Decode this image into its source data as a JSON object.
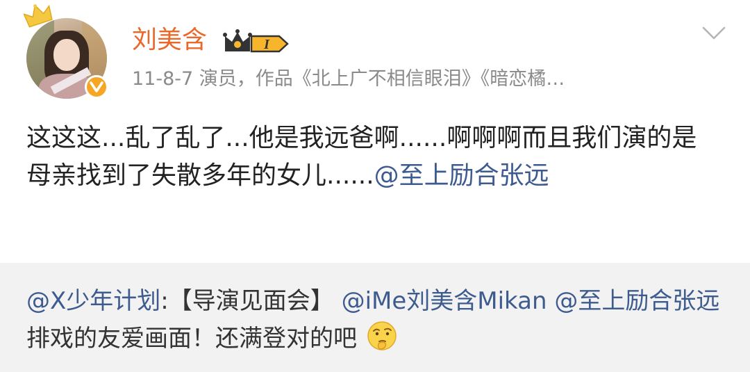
{
  "post": {
    "user_name": "刘美含",
    "vip_level": "I",
    "meta": "11-8-7  演员，作品《北上广不相信眼泪》《暗恋橘…",
    "content_text": "这这这...乱了乱了...他是我远爸啊......啊啊啊而且我们演的是母亲找到了失散多年的女儿......",
    "content_mention": "@至上励合张远",
    "icons": {
      "crown": "crown-icon",
      "verified": "verified-icon",
      "vip": "vip-badge-icon",
      "menu": "chevron-down-icon"
    }
  },
  "repost": {
    "mention_1": "@X少年计划",
    "text_1": ":【导演见面会】",
    "mention_2": "@iMe刘美含Mikan",
    "mention_3": "@至上励合张远",
    "text_2": " 排戏的友爱画面！还满登对的吧",
    "emoji": "thinking-face-emoji"
  },
  "colors": {
    "username": "#e9692a",
    "mention": "#3d5b8f",
    "meta": "#8a8a8a",
    "repost_bg": "#f2f2f2",
    "verified": "#f6a623"
  }
}
